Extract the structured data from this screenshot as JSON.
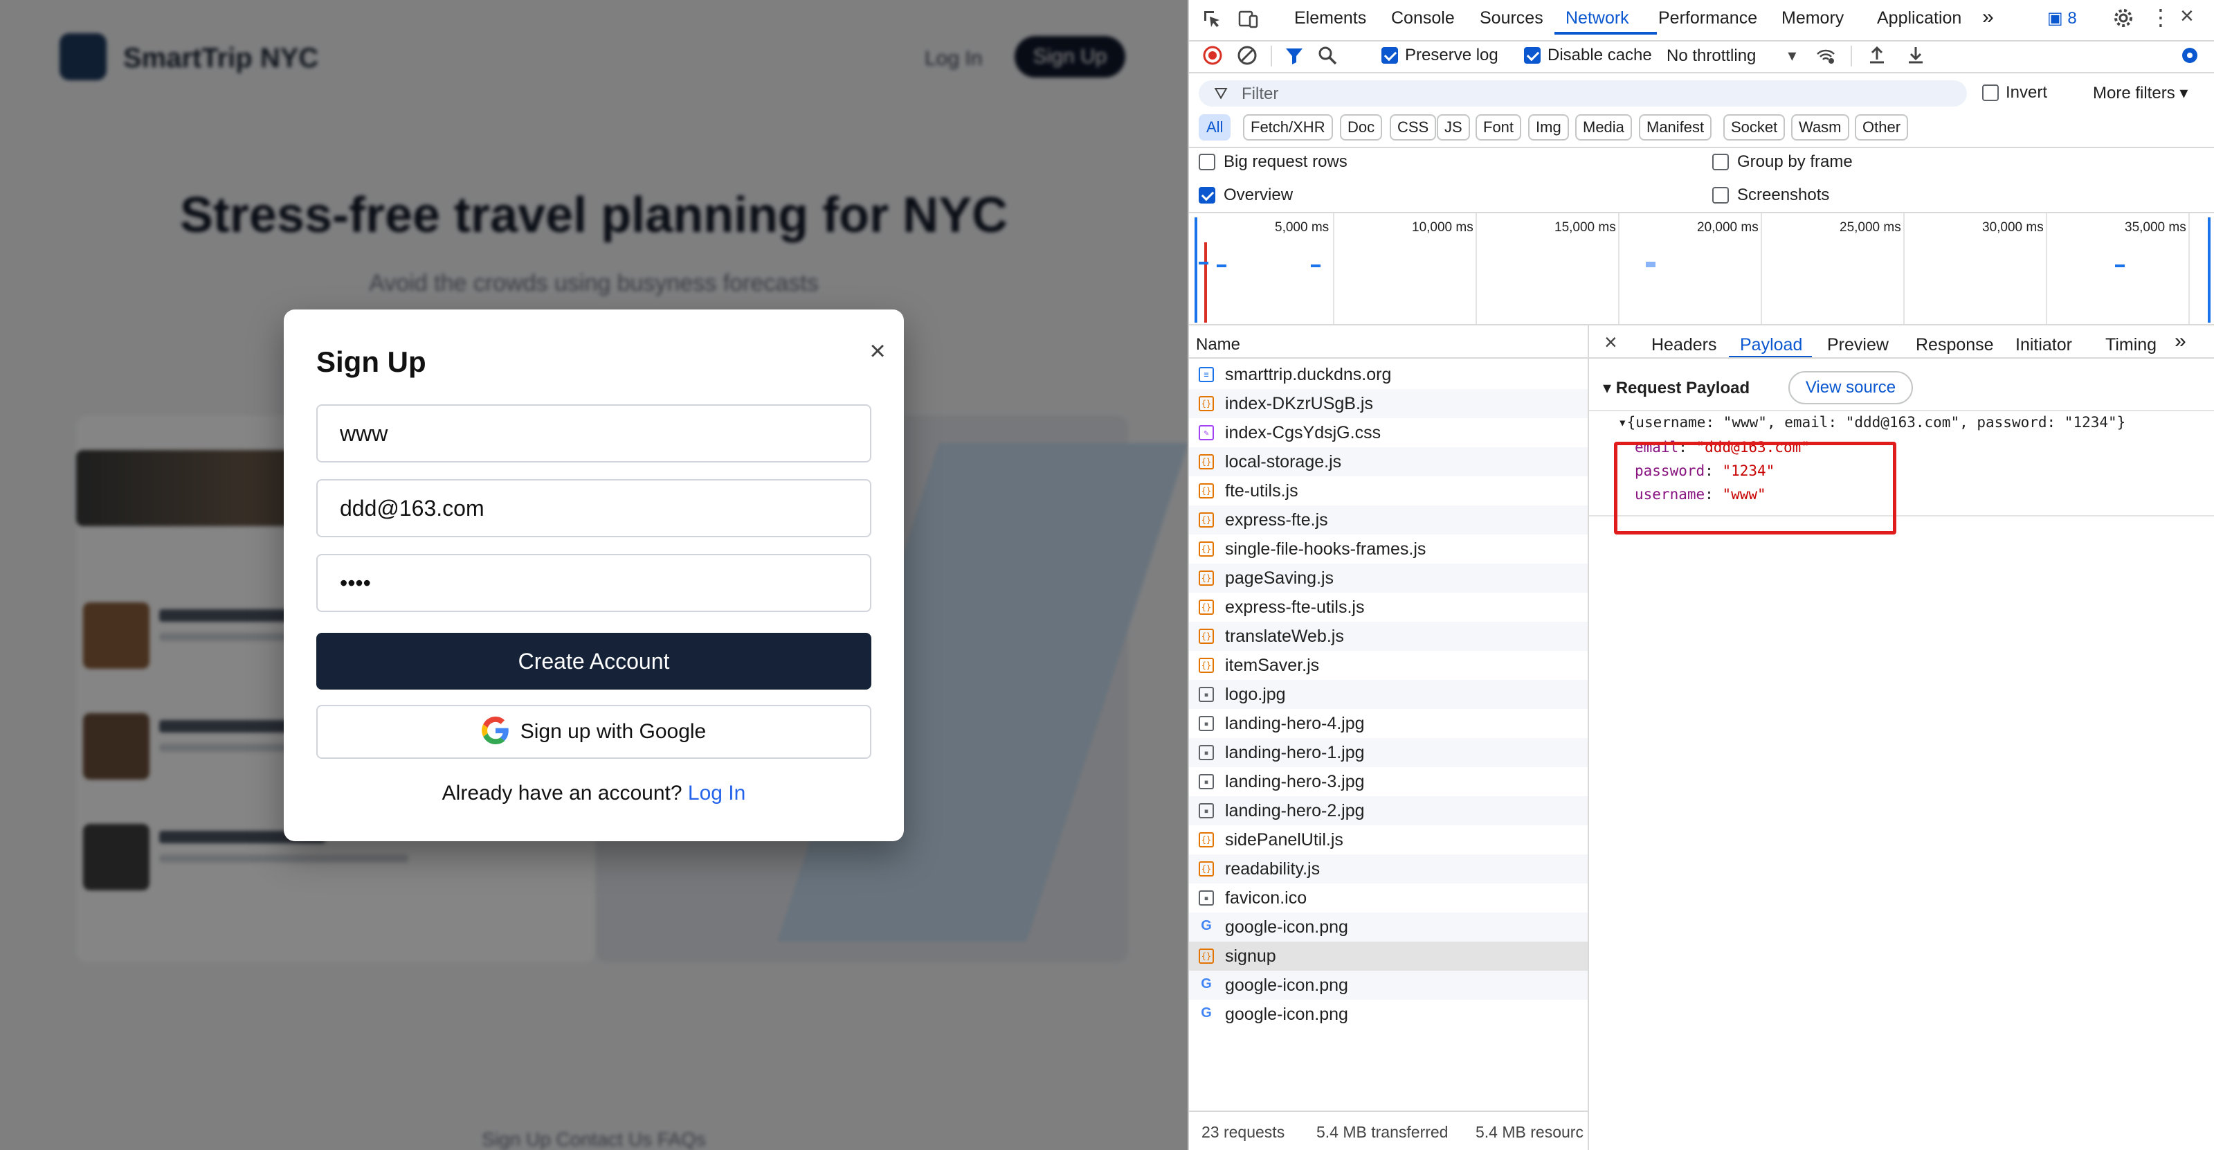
{
  "site": {
    "brand": "SmartTrip NYC",
    "login": "Log In",
    "signup": "Sign Up",
    "hero_title": "Stress-free travel planning for NYC",
    "hero_subtitle": "Avoid the crowds using busyness forecasts",
    "footer": "Sign Up     Contact Us     FAQs"
  },
  "modal": {
    "title": "Sign Up",
    "close": "×",
    "username_value": "www",
    "email_value": "ddd@163.com",
    "password_value": "••••",
    "create_button": "Create Account",
    "google_button": "Sign up with Google",
    "already_text": "Already have an account?",
    "login_link": "Log In"
  },
  "devtools": {
    "tabs": [
      "Elements",
      "Console",
      "Sources",
      "Network",
      "Performance",
      "Memory",
      "Application"
    ],
    "active_tab": "Network",
    "issues_count": "8",
    "toolbar": {
      "preserve_log": "Preserve log",
      "disable_cache": "Disable cache",
      "throttling": "No throttling"
    },
    "filter_placeholder": "Filter",
    "invert": "Invert",
    "more_filters": "More filters",
    "chips": [
      "All",
      "Fetch/XHR",
      "Doc",
      "CSS",
      "JS",
      "Font",
      "Img",
      "Media",
      "Manifest",
      "Socket",
      "Wasm",
      "Other"
    ],
    "options": {
      "big_rows": "Big request rows",
      "group_by_frame": "Group by frame",
      "overview": "Overview",
      "screenshots": "Screenshots"
    },
    "timeline_ticks": [
      "5,000 ms",
      "10,000 ms",
      "15,000 ms",
      "20,000 ms",
      "25,000 ms",
      "30,000 ms",
      "35,000 ms"
    ],
    "name_header": "Name",
    "requests": [
      {
        "name": "smarttrip.duckdns.org",
        "type": "doc"
      },
      {
        "name": "index-DKzrUSgB.js",
        "type": "js"
      },
      {
        "name": "index-CgsYdsjG.css",
        "type": "css"
      },
      {
        "name": "local-storage.js",
        "type": "js"
      },
      {
        "name": "fte-utils.js",
        "type": "js"
      },
      {
        "name": "express-fte.js",
        "type": "js"
      },
      {
        "name": "single-file-hooks-frames.js",
        "type": "js"
      },
      {
        "name": "pageSaving.js",
        "type": "js"
      },
      {
        "name": "express-fte-utils.js",
        "type": "js"
      },
      {
        "name": "translateWeb.js",
        "type": "js"
      },
      {
        "name": "itemSaver.js",
        "type": "js"
      },
      {
        "name": "logo.jpg",
        "type": "img"
      },
      {
        "name": "landing-hero-4.jpg",
        "type": "img"
      },
      {
        "name": "landing-hero-1.jpg",
        "type": "img"
      },
      {
        "name": "landing-hero-3.jpg",
        "type": "img"
      },
      {
        "name": "landing-hero-2.jpg",
        "type": "img"
      },
      {
        "name": "sidePanelUtil.js",
        "type": "js"
      },
      {
        "name": "readability.js",
        "type": "js"
      },
      {
        "name": "favicon.ico",
        "type": "img"
      },
      {
        "name": "google-icon.png",
        "type": "g"
      },
      {
        "name": "signup",
        "type": "fetch"
      },
      {
        "name": "google-icon.png",
        "type": "g"
      },
      {
        "name": "google-icon.png",
        "type": "g"
      }
    ],
    "selected_request": "signup",
    "detail_tabs": [
      "Headers",
      "Payload",
      "Preview",
      "Response",
      "Initiator",
      "Timing"
    ],
    "active_detail_tab": "Payload",
    "payload": {
      "section_title": "Request Payload",
      "view_source": "View source",
      "summary": "{username: \"www\", email: \"ddd@163.com\", password: \"1234\"}",
      "fields": [
        {
          "key": "email",
          "value": "\"ddd@163.com\""
        },
        {
          "key": "password",
          "value": "\"1234\""
        },
        {
          "key": "username",
          "value": "\"www\""
        }
      ]
    },
    "status": {
      "requests": "23 requests",
      "transferred": "5.4 MB transferred",
      "resources": "5.4 MB resourc"
    },
    "colors": {
      "accent": "#0b57d0",
      "highlight_box": "#e01b1b",
      "record": "#d93025"
    }
  }
}
